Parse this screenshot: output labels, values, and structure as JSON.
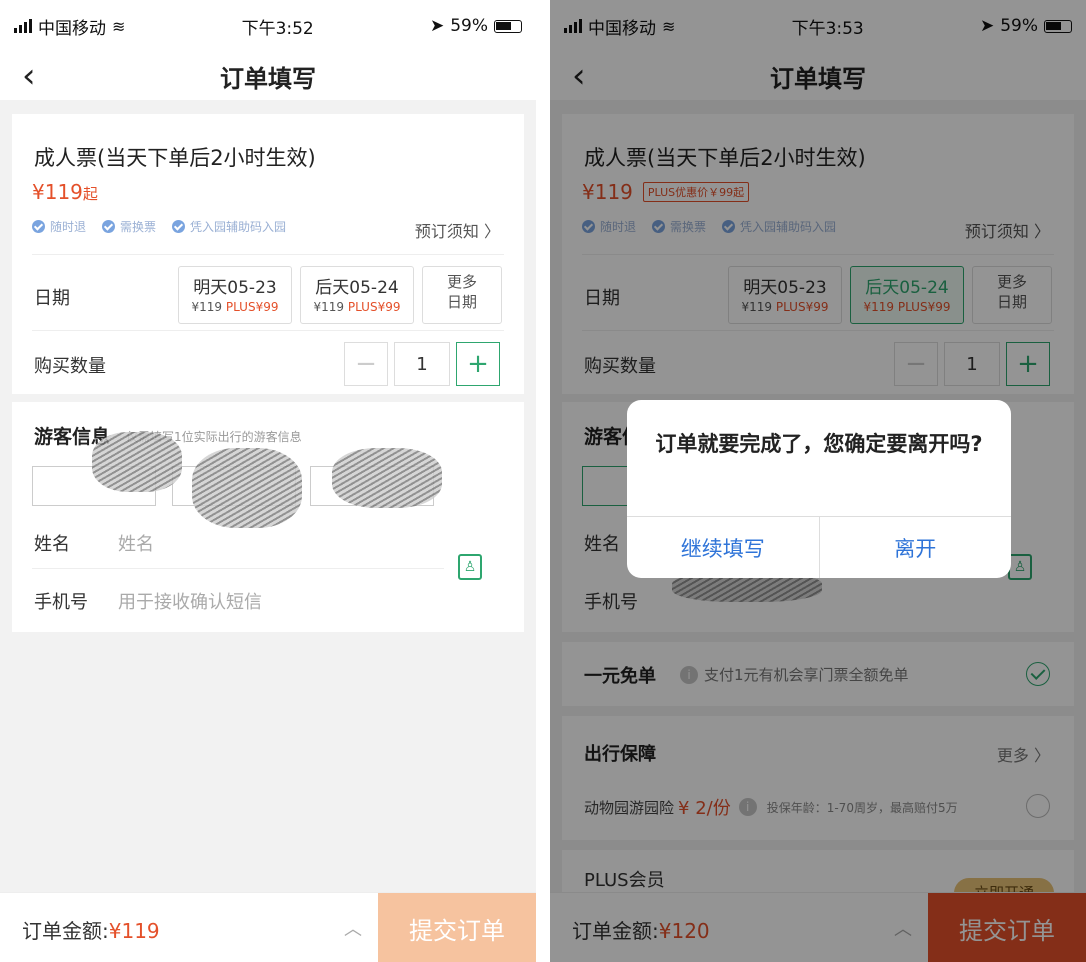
{
  "left": {
    "status": {
      "carrier": "中国移动",
      "time": "下午3:52",
      "battery": "59%"
    },
    "nav": {
      "back": "‹",
      "title": "订单填写"
    },
    "ticket": {
      "name": "成人票(当天下单后2小时生效)",
      "price": "¥119",
      "price_suffix": "起",
      "features": [
        "随时退",
        "需换票",
        "凭入园辅助码入园"
      ],
      "notice": "预订须知 〉"
    },
    "date": {
      "label": "日期",
      "options": [
        {
          "day": "明天05-23",
          "price": "¥119",
          "plus": "PLUS¥99"
        },
        {
          "day": "后天05-24",
          "price": "¥119",
          "plus": "PLUS¥99"
        }
      ],
      "more_line1": "更多",
      "more_line2": "日期"
    },
    "quantity": {
      "label": "购买数量",
      "minus": "−",
      "value": "1",
      "plus": "+"
    },
    "guest": {
      "title": "游客信息",
      "hint": "仅需填写1位实际出行的游客信息",
      "name_label": "姓名",
      "name_placeholder": "姓名",
      "phone_label": "手机号",
      "phone_placeholder": "用于接收确认短信"
    },
    "bottom": {
      "amount_label": "订单金额:",
      "amount": "¥119",
      "chevron": "︿",
      "submit": "提交订单"
    }
  },
  "right": {
    "status": {
      "carrier": "中国移动",
      "time": "下午3:53",
      "battery": "59%"
    },
    "nav": {
      "back": "‹",
      "title": "订单填写"
    },
    "ticket": {
      "name": "成人票(当天下单后2小时生效)",
      "price": "¥119",
      "plus_tag": "PLUS优惠价￥99起",
      "features": [
        "随时退",
        "需换票",
        "凭入园辅助码入园"
      ],
      "notice": "预订须知 〉"
    },
    "date": {
      "label": "日期",
      "options": [
        {
          "day": "明天05-23",
          "price": "¥119",
          "plus": "PLUS¥99"
        },
        {
          "day": "后天05-24",
          "price": "¥119",
          "plus": "PLUS¥99"
        }
      ],
      "more_line1": "更多",
      "more_line2": "日期"
    },
    "quantity": {
      "label": "购买数量",
      "minus": "−",
      "value": "1",
      "plus": "+"
    },
    "guest": {
      "title": "游客信",
      "name_label": "姓名",
      "phone_label": "手机号"
    },
    "one_yuan": {
      "title": "一元免单",
      "desc": "支付1元有机会享门票全额免单"
    },
    "travel": {
      "title": "出行保障",
      "more": "更多 〉",
      "insurance": "动物园游园险",
      "insurance_price": "¥ 2/份",
      "insurance_note": "投保年龄：1-70周岁，最高赔付5万"
    },
    "plus_member": {
      "title": "PLUS会员",
      "badge": "立即开通"
    },
    "bottom": {
      "amount_label": "订单金额:",
      "amount": "¥120",
      "chevron": "︿",
      "submit": "提交订单"
    },
    "dialog": {
      "message": "订单就要完成了，您确定要离开吗?",
      "continue": "继续填写",
      "leave": "离开"
    }
  },
  "colors": {
    "price_red": "#e4502a",
    "accent_green": "#2ea66f",
    "submit_light": "#f6c39f",
    "submit_dark": "#e4502a",
    "dialog_blue": "#2f74d8"
  }
}
